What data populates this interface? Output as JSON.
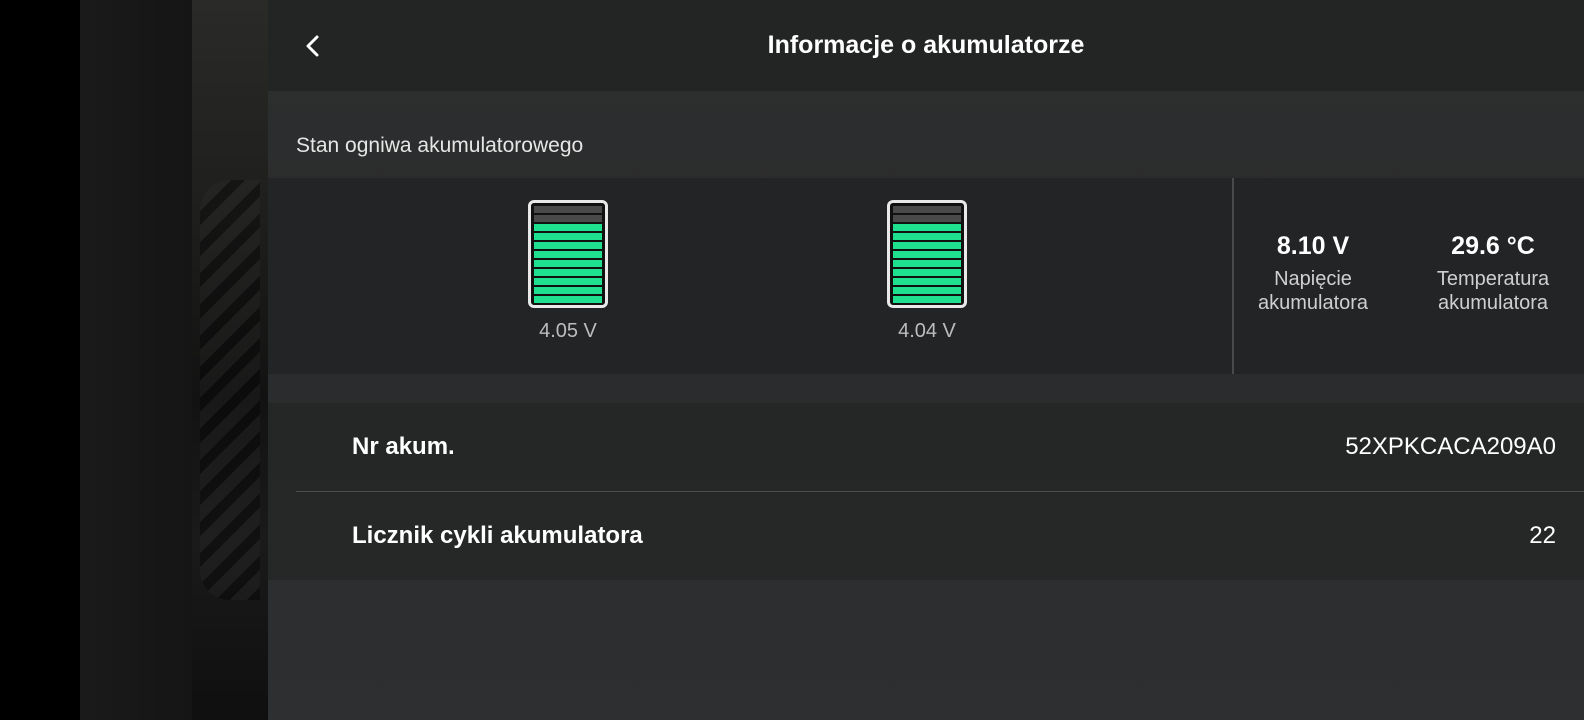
{
  "header": {
    "title": "Informacje o akumulatorze",
    "back_icon": "chevron-left-icon"
  },
  "cells_section": {
    "label": "Stan ogniwa akumulatorowego",
    "cells": [
      {
        "voltage": "4.05 V",
        "level_fraction": 0.82,
        "fill_color": "#1fe08e"
      },
      {
        "voltage": "4.04 V",
        "level_fraction": 0.82,
        "fill_color": "#1fe08e"
      }
    ]
  },
  "stats": {
    "voltage": {
      "value": "8.10 V",
      "label": "Napięcie akumulatora"
    },
    "temperature": {
      "value": "29.6 °C",
      "label": "Temperatura akumulatora"
    }
  },
  "info": {
    "serial": {
      "label": "Nr akum.",
      "value": "52XPKCACA209A0"
    },
    "cycles": {
      "label": "Licznik cykli akumulatora",
      "value": "22"
    }
  }
}
